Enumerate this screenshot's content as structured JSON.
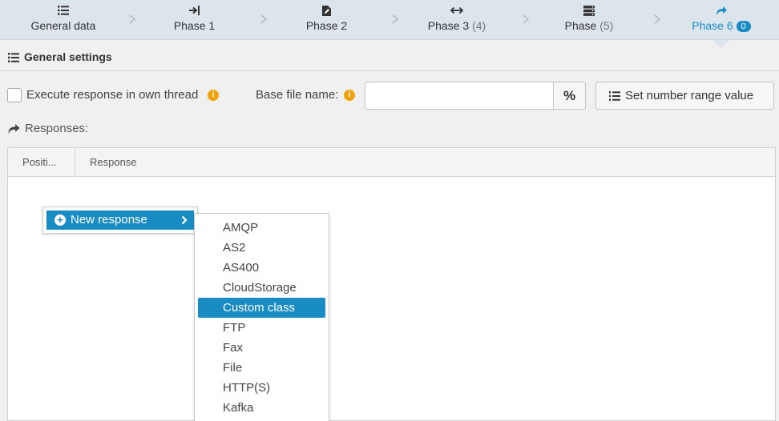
{
  "steps": [
    {
      "label": "General data",
      "icon": "list-icon",
      "count": "",
      "badge": ""
    },
    {
      "label": "Phase 1",
      "icon": "sign-in-icon",
      "count": "",
      "badge": ""
    },
    {
      "label": "Phase 2",
      "icon": "file-edit-icon",
      "count": "",
      "badge": ""
    },
    {
      "label": "Phase 3",
      "icon": "arrows-horizontal-icon",
      "count": "(4)",
      "badge": ""
    },
    {
      "label": "Phase",
      "icon": "server-icon",
      "count": "(5)",
      "badge": ""
    },
    {
      "label": "Phase 6",
      "icon": "share-arrow-icon",
      "count": "",
      "badge": "0"
    }
  ],
  "active_step": "Phase 6",
  "section": {
    "title": "General settings"
  },
  "form": {
    "execute_label": "Execute response in own thread",
    "execute_checked": false,
    "base_file_label": "Base file name:",
    "base_file_value": "",
    "percent_label": "%",
    "range_button_label": "Set number range value"
  },
  "responses": {
    "label": "Responses:",
    "columns": [
      "Positi...",
      "Response"
    ]
  },
  "new_response": {
    "label": "New response"
  },
  "menu": {
    "items": [
      "AMQP",
      "AS2",
      "AS400",
      "CloudStorage",
      "Custom class",
      "FTP",
      "Fax",
      "File",
      "HTTP(S)",
      "Kafka"
    ],
    "selected": "Custom class"
  },
  "colors": {
    "accent": "#1a8cc4",
    "info": "#f0a30a",
    "steps_bg": "#dce4ec"
  }
}
